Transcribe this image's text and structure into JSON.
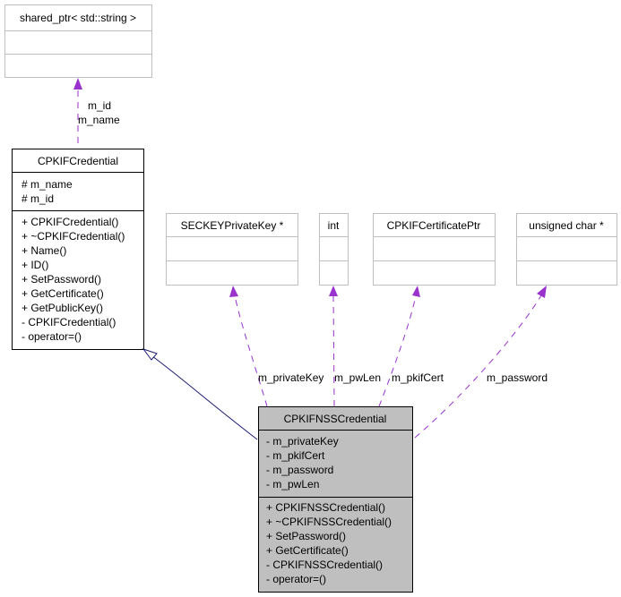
{
  "colors": {
    "composition_edge": "#9a32cd",
    "inheritance_edge": "#191970",
    "highlight_fill": "#bfbfbf",
    "external_border": "#bfbfbf"
  },
  "classes": {
    "shared_ptr": {
      "title": "shared_ptr< std::string >"
    },
    "base": {
      "title": "CPKIFCredential",
      "attributes": [
        "# m_name",
        "# m_id"
      ],
      "methods": [
        "+ CPKIFCredential()",
        "+ ~CPKIFCredential()",
        "+ Name()",
        "+ ID()",
        "+ SetPassword()",
        "+ GetCertificate()",
        "+ GetPublicKey()",
        "- CPKIFCredential()",
        "- operator=()"
      ]
    },
    "seckey": {
      "title": "SECKEYPrivateKey *"
    },
    "int": {
      "title": "int"
    },
    "certptr": {
      "title": "CPKIFCertificatePtr"
    },
    "uchar": {
      "title": "unsigned char *"
    },
    "main": {
      "title": "CPKIFNSSCredential",
      "attributes": [
        "- m_privateKey",
        "- m_pkifCert",
        "- m_password",
        "- m_pwLen"
      ],
      "methods": [
        "+ CPKIFNSSCredential()",
        "+ ~CPKIFNSSCredential()",
        "+ SetPassword()",
        "+ GetCertificate()",
        "- CPKIFNSSCredential()",
        "- operator=()"
      ]
    }
  },
  "edges": {
    "m_id": "m_id",
    "m_name": "m_name",
    "m_privateKey": "m_privateKey",
    "m_pwLen": "m_pwLen",
    "m_pkifCert": "m_pkifCert",
    "m_password": "m_password"
  }
}
